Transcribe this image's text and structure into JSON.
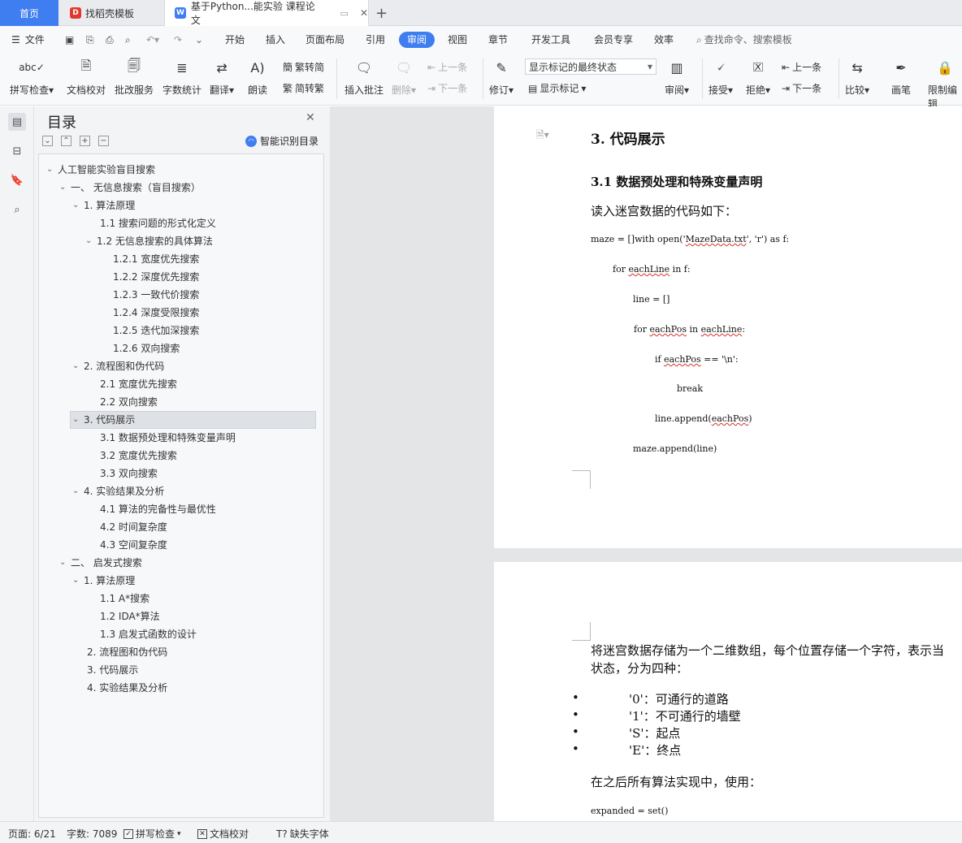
{
  "tabs": {
    "home": "首页",
    "template": "找稻壳模板",
    "doc": "基于Python...能实验 课程论文"
  },
  "menu": {
    "file": "文件",
    "items": [
      "开始",
      "插入",
      "页面布局",
      "引用",
      "审阅",
      "视图",
      "章节",
      "开发工具",
      "会员专享",
      "效率"
    ],
    "search_placeholder": "查找命令、搜索模板"
  },
  "ribbon": {
    "spell": "拼写检查",
    "doccheck": "文档校对",
    "batch": "批改服务",
    "wordcount": "字数统计",
    "translate": "翻译",
    "read": "朗读",
    "to_trad": "繁转简",
    "to_simp": "简转繁",
    "insert_comment": "插入批注",
    "delete": "删除",
    "prev": "上一条",
    "next": "下一条",
    "revise": "修订",
    "markup_select": "显示标记的最终状态",
    "show_markup": "显示标记",
    "review": "审阅",
    "accept": "接受",
    "reject": "拒绝",
    "prev2": "上一条",
    "next2": "下一条",
    "compare": "比较",
    "pen": "画笔",
    "restrict": "限制编辑"
  },
  "toc": {
    "title": "目录",
    "smart": "智能识别目录",
    "items": [
      "人工智能实验盲目搜索",
      "一、 无信息搜索（盲目搜索）",
      "1. 算法原理",
      "1.1 搜索问题的形式化定义",
      "1.2 无信息搜索的具体算法",
      "1.2.1 宽度优先搜索",
      "1.2.2 深度优先搜索",
      "1.2.3 一致代价搜索",
      "1.2.4 深度受限搜索",
      "1.2.5 迭代加深搜索",
      "1.2.6 双向搜索",
      "2. 流程图和伪代码",
      "2.1 宽度优先搜索",
      "2.2 双向搜索",
      "3. 代码展示",
      "3.1 数据预处理和特殊变量声明",
      "3.2 宽度优先搜索",
      "3.3 双向搜索",
      "4. 实验结果及分析",
      "4.1 算法的完备性与最优性",
      "4.2 时间复杂度",
      "4.3 空间复杂度",
      "二、 启发式搜索",
      "1. 算法原理",
      "1.1 A*搜索",
      "1.2 IDA*算法",
      "1.3 启发式函数的设计",
      "2. 流程图和伪代码",
      "3. 代码展示",
      "4. 实验结果及分析"
    ]
  },
  "doc": {
    "h1": "3.  代码展示",
    "h2": "3.1  数据预处理和特殊变量声明",
    "intro": "读入迷宫数据的代码如下：",
    "code": {
      "l1a": "maze = []with open('",
      "l1b": "MazeData.txt",
      "l1c": "', 'r') as f:",
      "l2a": "for ",
      "l2b": "eachLine",
      "l2c": " in f:",
      "l3": "line = []",
      "l4a": "for ",
      "l4b": "eachPos",
      "l4c": " in ",
      "l4d": "eachLine",
      "l4e": ":",
      "l5a": "if ",
      "l5b": "eachPos",
      "l5c": " == '\\n':",
      "l6": "break",
      "l7a": "line.append(",
      "l7b": "eachPos",
      "l7c": ")",
      "l8": "maze.append(line)"
    },
    "p2_line1": "将迷宫数据存储为一个二维数组，每个位置存储一个字符，表示当",
    "p2_line2": "状态，分为四种：",
    "bullets": [
      "'0'：可通行的道路",
      "'1'：不可通行的墙壁",
      "'S'：起点",
      "'E'：终点"
    ],
    "p3": "在之后所有算法实现中，使用：",
    "p4": "expanded = set()"
  },
  "status": {
    "page": "页面: 6/21",
    "words": "字数: 7089",
    "spell": "拼写检查",
    "doccheck": "文档校对",
    "missing_font": "缺失字体"
  },
  "colors": {
    "accent": "#3f7ef0",
    "error_underline": "#d0342c"
  }
}
